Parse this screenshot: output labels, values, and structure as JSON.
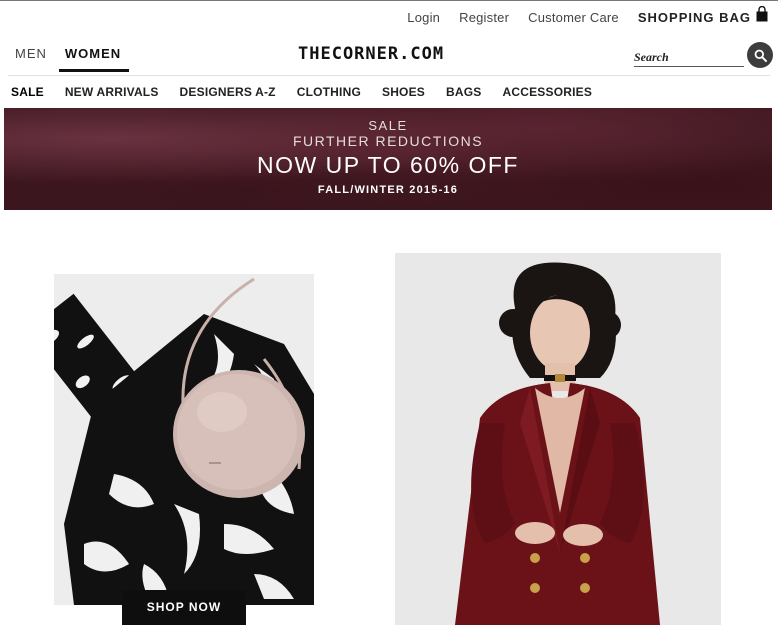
{
  "utility_nav": {
    "login": "Login",
    "register": "Register",
    "customer_care": "Customer Care",
    "shopping_bag": "SHOPPING BAG"
  },
  "gender_tabs": [
    {
      "label": "MEN",
      "active": false
    },
    {
      "label": "WOMEN",
      "active": true
    }
  ],
  "logo": "THECORNER.COM",
  "search": {
    "placeholder": "Search"
  },
  "main_nav": [
    "SALE",
    "NEW ARRIVALS",
    "DESIGNERS A-Z",
    "CLOTHING",
    "SHOES",
    "BAGS",
    "ACCESSORIES"
  ],
  "banner": {
    "line1": "SALE",
    "line2": "FURTHER REDUCTIONS",
    "line3": "NOW UP TO 60% OFF",
    "line4": "FALL/WINTER 2015-16"
  },
  "promo_left": {
    "cta": "SHOP NOW"
  },
  "colors": {
    "banner_bg": "#3d171f",
    "cta_bg": "#0e0e0e",
    "blazer": "#6b1218"
  }
}
